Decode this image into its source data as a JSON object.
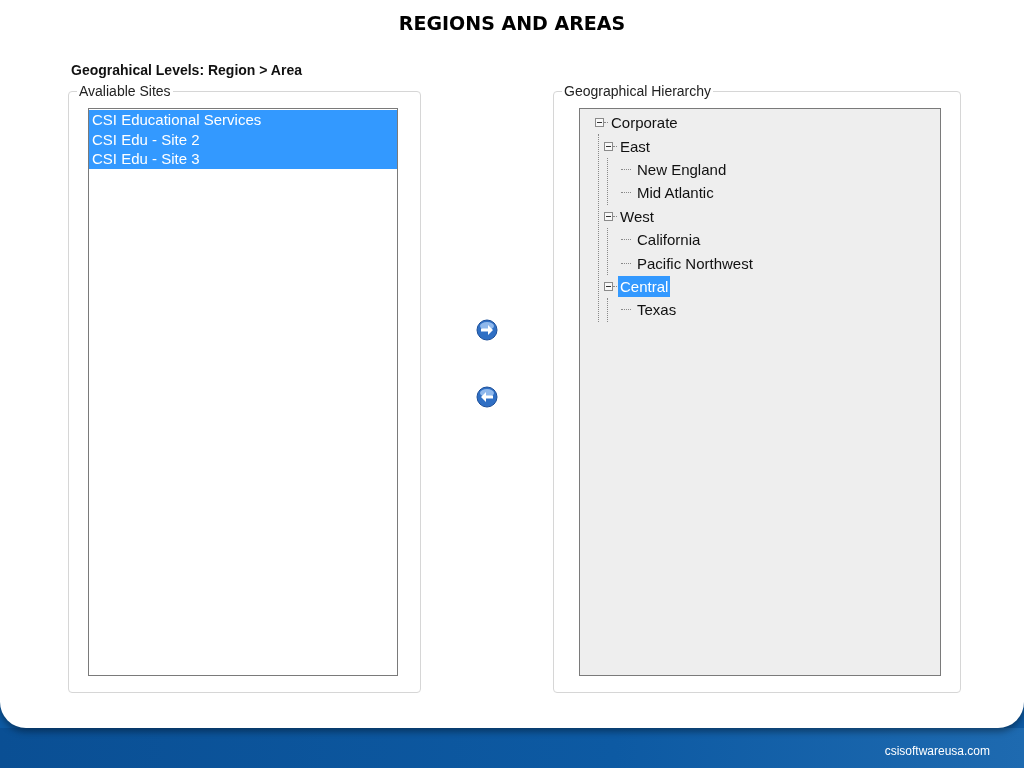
{
  "title": "REGIONS AND AREAS",
  "levels_label": "Geograhical Levels: Region > Area",
  "available_sites": {
    "legend": "Avaliable Sites",
    "items": [
      {
        "label": "CSI Educational Services",
        "selected": true
      },
      {
        "label": "CSI Edu - Site 2",
        "selected": true
      },
      {
        "label": "CSI Edu - Site 3",
        "selected": true
      }
    ]
  },
  "hierarchy": {
    "legend": "Geographical Hierarchy",
    "tree": [
      {
        "label": "Corporate",
        "expanded": true,
        "selected": false,
        "children": [
          {
            "label": "East",
            "expanded": true,
            "selected": false,
            "children": [
              {
                "label": "New England",
                "selected": false
              },
              {
                "label": "Mid Atlantic",
                "selected": false
              }
            ]
          },
          {
            "label": "West",
            "expanded": true,
            "selected": false,
            "children": [
              {
                "label": "California",
                "selected": false
              },
              {
                "label": "Pacific Northwest",
                "selected": false
              }
            ]
          },
          {
            "label": "Central",
            "expanded": true,
            "selected": true,
            "children": [
              {
                "label": "Texas",
                "selected": false
              }
            ]
          }
        ]
      }
    ]
  },
  "footer": {
    "website": "csisoftwareusa.com"
  }
}
